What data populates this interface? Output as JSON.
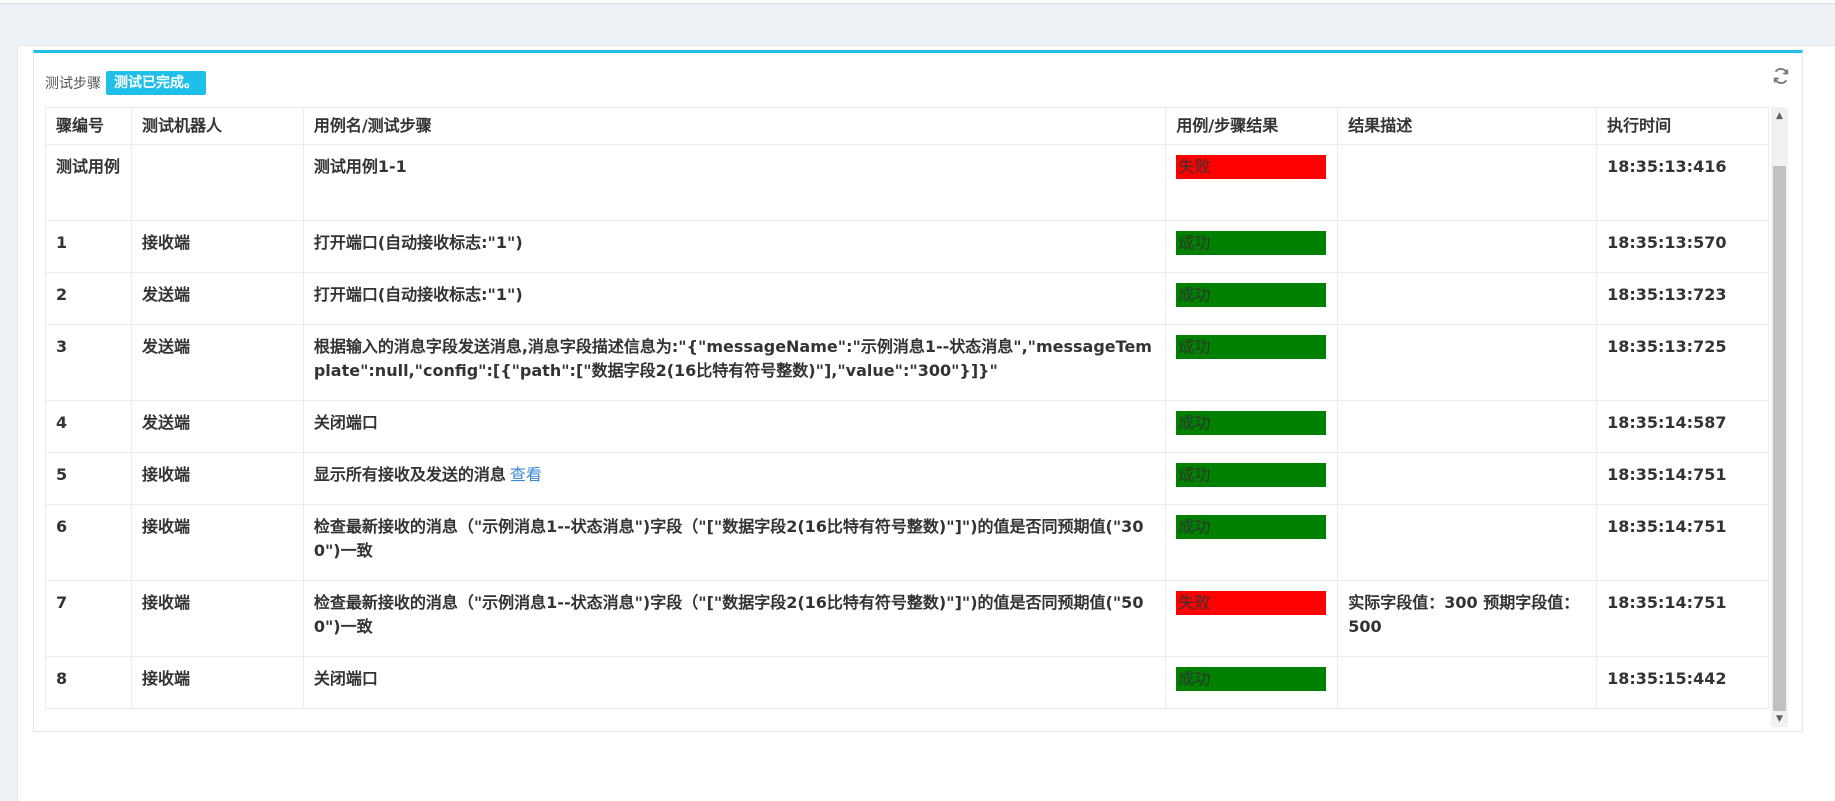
{
  "panel": {
    "title": "测试步骤",
    "status_badge": "测试已完成。"
  },
  "table": {
    "headers": {
      "step_no": "骤编号",
      "robot": "测试机器人",
      "name": "用例名/测试步骤",
      "result": "用例/步骤结果",
      "description": "结果描述",
      "time": "执行时间"
    },
    "rows": [
      {
        "step": "测试用例",
        "robot": "",
        "name": "测试用例1-1",
        "link": "",
        "result": "失败",
        "status": "fail",
        "desc": "",
        "time": "18:35:13:416"
      },
      {
        "step": "1",
        "robot": "接收端",
        "name": "打开端口(自动接收标志:\"1\")",
        "link": "",
        "result": "成功",
        "status": "ok",
        "desc": "",
        "time": "18:35:13:570"
      },
      {
        "step": "2",
        "robot": "发送端",
        "name": "打开端口(自动接收标志:\"1\")",
        "link": "",
        "result": "成功",
        "status": "ok",
        "desc": "",
        "time": "18:35:13:723"
      },
      {
        "step": "3",
        "robot": "发送端",
        "name": "根据输入的消息字段发送消息,消息字段描述信息为:\"{\"messageName\":\"示例消息1--状态消息\",\"messageTemplate\":null,\"config\":[{\"path\":[\"数据字段2(16比特有符号整数)\"],\"value\":\"300\"}]}\"",
        "link": "",
        "result": "成功",
        "status": "ok",
        "desc": "",
        "time": "18:35:13:725"
      },
      {
        "step": "4",
        "robot": "发送端",
        "name": "关闭端口",
        "link": "",
        "result": "成功",
        "status": "ok",
        "desc": "",
        "time": "18:35:14:587"
      },
      {
        "step": "5",
        "robot": "接收端",
        "name": "显示所有接收及发送的消息",
        "link": "查看",
        "result": "成功",
        "status": "ok",
        "desc": "",
        "time": "18:35:14:751"
      },
      {
        "step": "6",
        "robot": "接收端",
        "name": "检查最新接收的消息（\"示例消息1--状态消息\")字段（\"[\"数据字段2(16比特有符号整数)\"]\")的值是否同预期值(\"300\")一致",
        "link": "",
        "result": "成功",
        "status": "ok",
        "desc": "",
        "time": "18:35:14:751"
      },
      {
        "step": "7",
        "robot": "接收端",
        "name": "检查最新接收的消息（\"示例消息1--状态消息\")字段（\"[\"数据字段2(16比特有符号整数)\"]\")的值是否同预期值(\"500\")一致",
        "link": "",
        "result": "失败",
        "status": "fail",
        "desc": "实际字段值：300 预期字段值：500",
        "time": "18:35:14:751"
      },
      {
        "step": "8",
        "robot": "接收端",
        "name": "关闭端口",
        "link": "",
        "result": "成功",
        "status": "ok",
        "desc": "",
        "time": "18:35:15:442"
      }
    ]
  },
  "icons": {
    "refresh": "refresh-icon",
    "scroll_up": "scroll-up-arrow-icon",
    "scroll_down": "scroll-down-arrow-icon"
  },
  "colors": {
    "accent": "#1ebfe8",
    "fail": "#ff0000",
    "success": "#008000",
    "link": "#3a8ad6"
  }
}
